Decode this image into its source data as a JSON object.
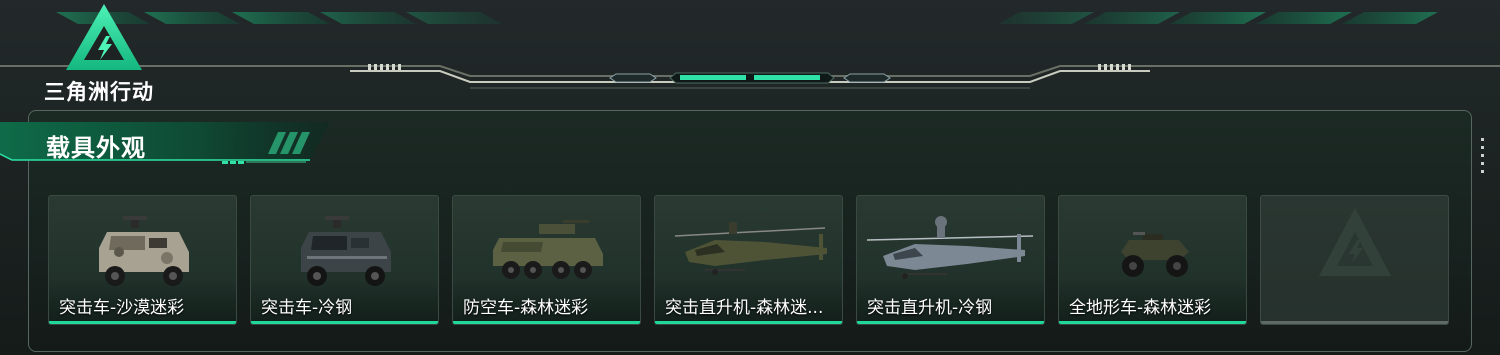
{
  "app": {
    "logo_text": "三角洲行动"
  },
  "section": {
    "title": "载具外观"
  },
  "colors": {
    "accent": "#1fd89a",
    "panel_border": "#556760",
    "empty_bar": "#5d6a65"
  },
  "vehicles": [
    {
      "label": "突击车-沙漠迷彩",
      "icon": "armored-car-desert-icon",
      "selected": true
    },
    {
      "label": "突击车-冷钢",
      "icon": "armored-car-steel-icon",
      "selected": true
    },
    {
      "label": "防空车-森林迷彩",
      "icon": "anti-air-vehicle-icon",
      "selected": true
    },
    {
      "label": "突击直升机-森林迷...",
      "icon": "attack-helicopter-forest-icon",
      "selected": true
    },
    {
      "label": "突击直升机-冷钢",
      "icon": "attack-helicopter-steel-icon",
      "selected": true
    },
    {
      "label": "全地形车-森林迷彩",
      "icon": "atv-icon",
      "selected": true
    },
    {
      "label": "",
      "icon": "empty-slot-logo-icon",
      "selected": false
    }
  ]
}
